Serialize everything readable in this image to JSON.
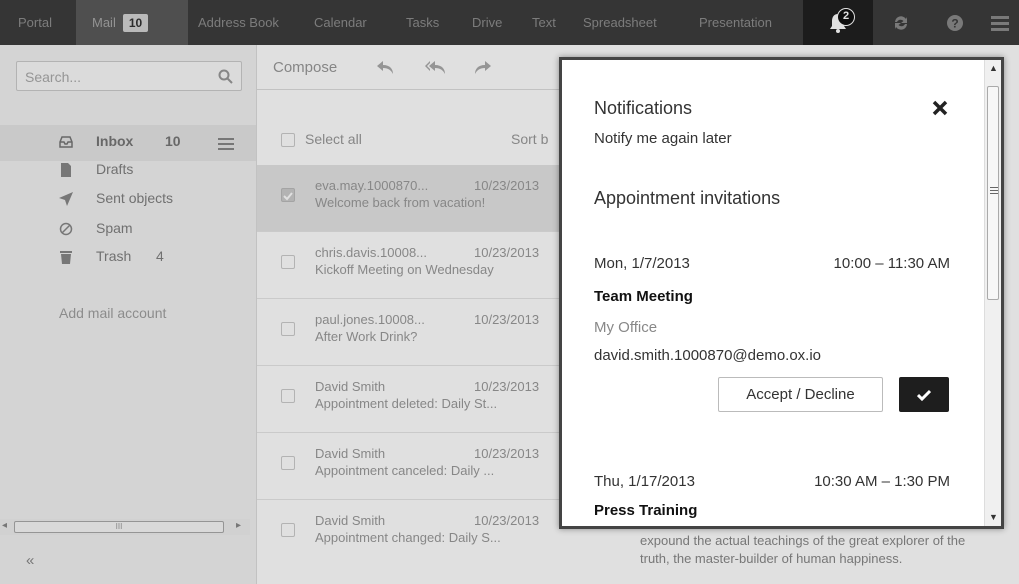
{
  "topbar": {
    "apps": [
      "Portal",
      "Mail",
      "Address Book",
      "Calendar",
      "Tasks",
      "Drive",
      "Text",
      "Spreadsheet",
      "Presentation"
    ],
    "mail_badge": "10",
    "notification_count": "2",
    "icons": [
      "bell-icon",
      "refresh-icon",
      "help-icon",
      "menu-icon"
    ]
  },
  "sidebar": {
    "search_placeholder": "Search...",
    "folders": [
      {
        "label": "Inbox",
        "count": "10",
        "icon": "inbox-icon"
      },
      {
        "label": "Drafts",
        "count": "",
        "icon": "document-icon"
      },
      {
        "label": "Sent objects",
        "count": "",
        "icon": "send-icon"
      },
      {
        "label": "Spam",
        "count": "",
        "icon": "block-icon"
      },
      {
        "label": "Trash",
        "count": "4",
        "icon": "trash-icon"
      }
    ],
    "add_account": "Add mail account",
    "scroll_marker": "III",
    "collapse": "«"
  },
  "list": {
    "compose": "Compose",
    "select_all": "Select all",
    "sort": "Sort b",
    "mails": [
      {
        "from": "eva.may.1000870...",
        "date": "10/23/2013",
        "subject": "Welcome back from vacation!",
        "selected": true
      },
      {
        "from": "chris.davis.10008...",
        "date": "10/23/2013",
        "subject": "Kickoff Meeting on Wednesday",
        "selected": false
      },
      {
        "from": "paul.jones.10008...",
        "date": "10/23/2013",
        "subject": "After Work Drink?",
        "selected": false
      },
      {
        "from": "David Smith",
        "date": "10/23/2013",
        "subject": "Appointment deleted: Daily St...",
        "selected": false
      },
      {
        "from": "David Smith",
        "date": "10/23/2013",
        "subject": "Appointment canceled: Daily ...",
        "selected": false
      },
      {
        "from": "David Smith",
        "date": "10/23/2013",
        "subject": "Appointment changed: Daily S...",
        "selected": false
      }
    ]
  },
  "reading": {
    "text": "expound the actual teachings of the great explorer of the truth, the master-builder of human happiness."
  },
  "notifications": {
    "title": "Notifications",
    "notify_later": "Notify me again later",
    "section": "Appointment invitations",
    "appointments": [
      {
        "date": "Mon, 1/7/2013",
        "time": "10:00 – 11:30 AM",
        "title": "Team Meeting",
        "location": "My Office",
        "organizer": "david.smith.1000870@demo.ox.io",
        "accept": "Accept / Decline"
      },
      {
        "date": "Thu, 1/17/2013",
        "time": "10:30 AM – 1:30 PM",
        "title": "Press Training",
        "location": "",
        "organizer": "",
        "accept": ""
      }
    ]
  },
  "colors": {
    "topbar": "#3d3d3d",
    "active_app": "#5a5a5a",
    "bell_bg": "#202020",
    "confirm_btn": "#1e1e1e"
  }
}
